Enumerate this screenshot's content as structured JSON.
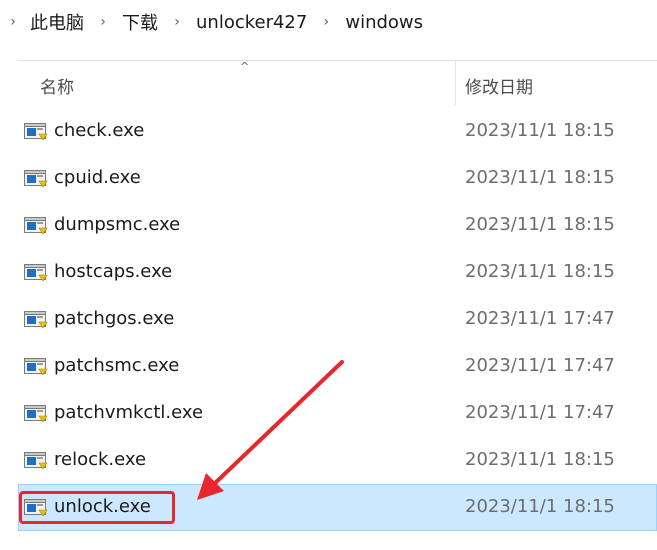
{
  "breadcrumb": {
    "items": [
      "此电脑",
      "下载",
      "unlocker427",
      "windows"
    ],
    "separator": "›"
  },
  "header": {
    "name_label": "名称",
    "date_label": "修改日期",
    "sort_indicator": "^"
  },
  "files": [
    {
      "name": "check.exe",
      "modified": "2023/11/1 18:15",
      "selected": false
    },
    {
      "name": "cpuid.exe",
      "modified": "2023/11/1 18:15",
      "selected": false
    },
    {
      "name": "dumpsmc.exe",
      "modified": "2023/11/1 18:15",
      "selected": false
    },
    {
      "name": "hostcaps.exe",
      "modified": "2023/11/1 18:15",
      "selected": false
    },
    {
      "name": "patchgos.exe",
      "modified": "2023/11/1 17:47",
      "selected": false
    },
    {
      "name": "patchsmc.exe",
      "modified": "2023/11/1 17:47",
      "selected": false
    },
    {
      "name": "patchvmkctl.exe",
      "modified": "2023/11/1 17:47",
      "selected": false
    },
    {
      "name": "relock.exe",
      "modified": "2023/11/1 18:15",
      "selected": false
    },
    {
      "name": "unlock.exe",
      "modified": "2023/11/1 18:15",
      "selected": true
    }
  ],
  "colors": {
    "selection_bg": "#cce8ff",
    "annotation_red": "#e8262b"
  },
  "icons": {
    "file": "exe-file-icon",
    "annotation": "red-arrow-annotation"
  }
}
